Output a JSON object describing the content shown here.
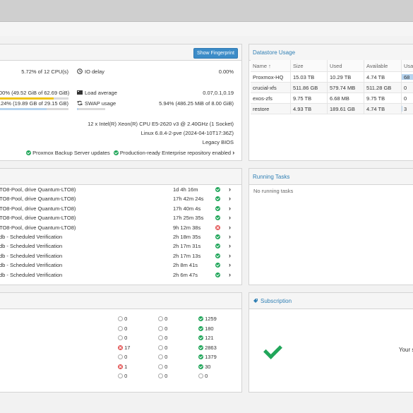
{
  "status": {
    "fingerprint_button": "Show Fingerprint",
    "cpu_usage": "5.72% of 12 CPU(s)",
    "io_delay_label": "IO delay",
    "io_delay_value": "0.00%",
    "ram_usage": "00% (49.52 GiB of 62.69 GiB)",
    "ram_fill": 0.79,
    "load_label": "Load average",
    "load_value": "0.07,0.1,0.19",
    "hd_usage": ".24% (19.89 GB of 29.15 GB)",
    "hd_fill": 0.68,
    "swap_label": "SWAP usage",
    "swap_value": "5.94% (486.25 MiB of 8.00 GiB)",
    "cpu_model": "12 x Intel(R) Xeon(R) CPU E5-2620 v3 @ 2.40GHz (1 Socket)",
    "kernel": "Linux 6.8.4-2-pve (2024-04-10T17:36Z)",
    "boot_mode": "Legacy BIOS",
    "updates_label": "Proxmox Backup Server updates",
    "repo_label": "Production-ready Enterprise repository enabled"
  },
  "datastore": {
    "title": "Datastore Usage",
    "columns": [
      "Name ↑",
      "Size",
      "Used",
      "Available",
      "Usag"
    ],
    "rows": [
      {
        "name": "Proxmox-HQ",
        "size": "15.03 TB",
        "used": "10.29 TB",
        "avail": "4.74 TB",
        "usage": "68",
        "fill": 0.68
      },
      {
        "name": "crucial-xfs",
        "size": "511.86 GB",
        "used": "579.74 MB",
        "avail": "511.28 GB",
        "usage": "0",
        "fill": 0.0
      },
      {
        "name": "exos-zfs",
        "size": "9.75 TB",
        "used": "6.68 MB",
        "avail": "9.75 TB",
        "usage": "0",
        "fill": 0.0
      },
      {
        "name": "restore",
        "size": "4.93 TB",
        "used": "189.61 GB",
        "avail": "4.74 TB",
        "usage": "3",
        "fill": 0.04
      }
    ]
  },
  "tasks": {
    "rows": [
      {
        "desc": "TO8-Pool, drive Quantum-LTO8)",
        "dur": "1d 4h 16m",
        "status": "ok"
      },
      {
        "desc": "TO8-Pool, drive Quantum-LTO8)",
        "dur": "17h 42m 24s",
        "status": "ok"
      },
      {
        "desc": "TO8-Pool, drive Quantum-LTO8)",
        "dur": "17h 40m 4s",
        "status": "ok"
      },
      {
        "desc": "TO8-Pool, drive Quantum-LTO8)",
        "dur": "17h 25m 35s",
        "status": "ok"
      },
      {
        "desc": "TO8-Pool, drive Quantum-LTO8)",
        "dur": "9h 12m 38s",
        "status": "err"
      },
      {
        "desc": "db - Scheduled Verification",
        "dur": "2h 18m 35s",
        "status": "ok"
      },
      {
        "desc": "db - Scheduled Verification",
        "dur": "2h 17m 31s",
        "status": "ok"
      },
      {
        "desc": "db - Scheduled Verification",
        "dur": "2h 17m 13s",
        "status": "ok"
      },
      {
        "desc": "db - Scheduled Verification",
        "dur": "2h 8m 41s",
        "status": "ok"
      },
      {
        "desc": "db - Scheduled Verification",
        "dur": "2h 6m 47s",
        "status": "ok"
      }
    ]
  },
  "running": {
    "title": "Running Tasks",
    "empty": "No running tasks"
  },
  "counts": {
    "rows": [
      {
        "a": "0",
        "a_s": "zero",
        "b": "0",
        "b_s": "zero",
        "c": "1259",
        "c_s": "ok"
      },
      {
        "a": "0",
        "a_s": "zero",
        "b": "0",
        "b_s": "zero",
        "c": "180",
        "c_s": "ok"
      },
      {
        "a": "0",
        "a_s": "zero",
        "b": "0",
        "b_s": "zero",
        "c": "121",
        "c_s": "ok"
      },
      {
        "a": "17",
        "a_s": "err",
        "b": "0",
        "b_s": "zero",
        "c": "2863",
        "c_s": "ok"
      },
      {
        "a": "0",
        "a_s": "zero",
        "b": "0",
        "b_s": "zero",
        "c": "1379",
        "c_s": "ok"
      },
      {
        "a": "1",
        "a_s": "err",
        "b": "0",
        "b_s": "zero",
        "c": "30",
        "c_s": "ok"
      },
      {
        "a": "0",
        "a_s": "zero",
        "b": "0",
        "b_s": "zero",
        "c": "0",
        "c_s": "zero"
      }
    ]
  },
  "subscription": {
    "title": "Subscription",
    "text": "Your s"
  }
}
